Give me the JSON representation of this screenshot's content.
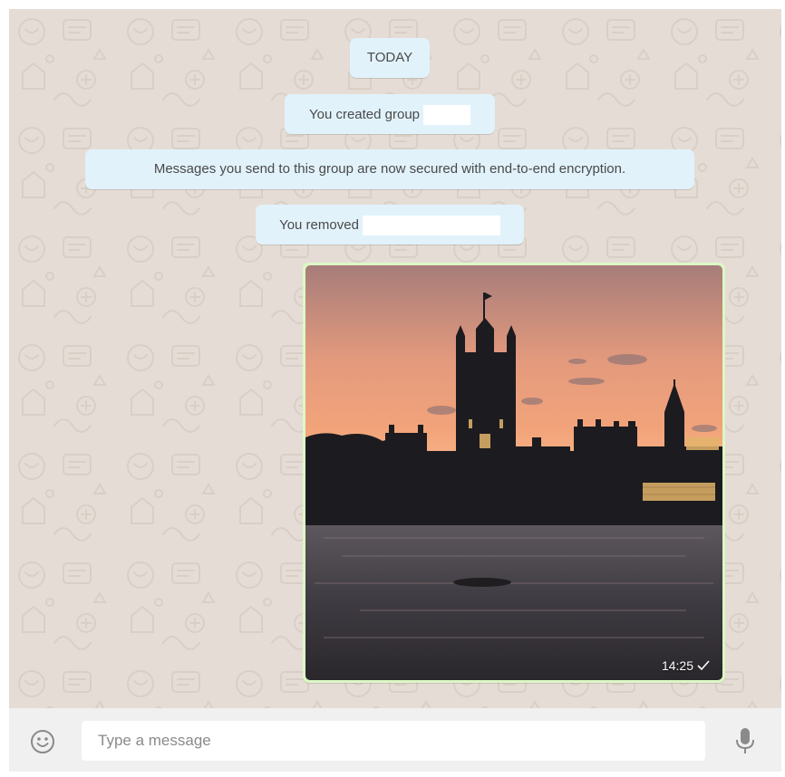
{
  "conversation": {
    "date_divider": "TODAY",
    "system_messages": [
      "You created group",
      "Messages you send to this group are now secured with end-to-end encryption.",
      "You removed"
    ]
  },
  "media_message": {
    "time": "14:25",
    "status_icon": "single-check-icon",
    "direction": "outgoing",
    "content_type": "image"
  },
  "composer": {
    "placeholder": "Type a message",
    "emoji_icon": "smiley-icon",
    "mic_icon": "microphone-icon"
  },
  "colors": {
    "chat_background": "#e5ddd5",
    "system_bubble": "#e1f2fb",
    "outgoing_bubble": "#dcf8c6",
    "composer_background": "#f0f0f0"
  }
}
